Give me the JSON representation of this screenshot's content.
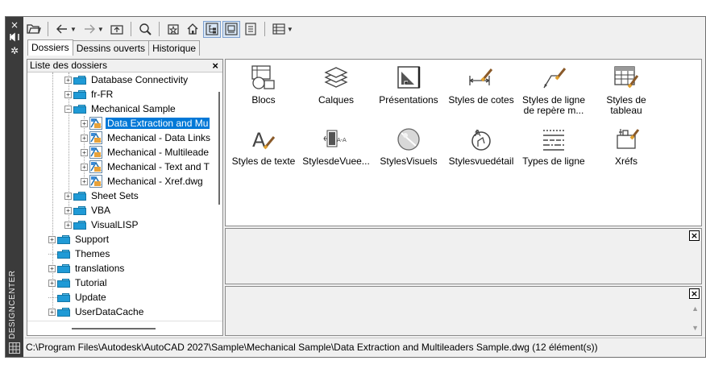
{
  "window": {
    "side_title": "DESIGNCENTER",
    "close_glyph": "×",
    "autohide_glyph": "⧓",
    "props_glyph": "✲"
  },
  "tabs": [
    {
      "label": "Dossiers",
      "active": true
    },
    {
      "label": "Dessins ouverts",
      "active": false
    },
    {
      "label": "Historique",
      "active": false
    }
  ],
  "tree": {
    "header": "Liste des dossiers",
    "close_glyph": "×",
    "rows": [
      {
        "label": "Database Connectivity",
        "level": 2,
        "expander": "+",
        "icon": "folder"
      },
      {
        "label": "fr-FR",
        "level": 2,
        "expander": "+",
        "icon": "folder"
      },
      {
        "label": "Mechanical Sample",
        "level": 2,
        "expander": "−",
        "icon": "folder"
      },
      {
        "label": "Data Extraction and Mu",
        "level": 3,
        "expander": "+",
        "icon": "dwg",
        "selected": true
      },
      {
        "label": "Mechanical - Data Links",
        "level": 3,
        "expander": "+",
        "icon": "dwg"
      },
      {
        "label": "Mechanical - Multileade",
        "level": 3,
        "expander": "+",
        "icon": "dwg"
      },
      {
        "label": "Mechanical - Text and T",
        "level": 3,
        "expander": "+",
        "icon": "dwg"
      },
      {
        "label": "Mechanical - Xref.dwg",
        "level": 3,
        "expander": "+",
        "icon": "dwg"
      },
      {
        "label": "Sheet Sets",
        "level": 2,
        "expander": "+",
        "icon": "folder"
      },
      {
        "label": "VBA",
        "level": 2,
        "expander": "+",
        "icon": "folder"
      },
      {
        "label": "VisualLISP",
        "level": 2,
        "expander": "+",
        "icon": "folder"
      },
      {
        "label": "Support",
        "level": 1,
        "expander": "+",
        "icon": "folder"
      },
      {
        "label": "Themes",
        "level": 1,
        "expander": "",
        "icon": "folder"
      },
      {
        "label": "translations",
        "level": 1,
        "expander": "+",
        "icon": "folder"
      },
      {
        "label": "Tutorial",
        "level": 1,
        "expander": "+",
        "icon": "folder"
      },
      {
        "label": "Update",
        "level": 1,
        "expander": "",
        "icon": "folder"
      },
      {
        "label": "UserDataCache",
        "level": 1,
        "expander": "+",
        "icon": "folder"
      }
    ]
  },
  "content": {
    "items": [
      {
        "label": "Blocs",
        "icon": "blocks-icon"
      },
      {
        "label": "Calques",
        "icon": "layers-icon"
      },
      {
        "label": "Présentations",
        "icon": "layouts-icon"
      },
      {
        "label": "Styles de cotes",
        "icon": "dimstyles-icon"
      },
      {
        "label": "Styles de ligne de repère m...",
        "icon": "mleaderstyles-icon"
      },
      {
        "label": "Styles de tableau",
        "icon": "tablestyles-icon"
      },
      {
        "label": "Styles de texte",
        "icon": "textstyles-icon"
      },
      {
        "label": "StylesdeVuee...",
        "icon": "viewstyles-icon"
      },
      {
        "label": "StylesVisuels",
        "icon": "visualstyles-icon"
      },
      {
        "label": "Stylesvuedétail",
        "icon": "detailviewstyles-icon"
      },
      {
        "label": "Types de ligne",
        "icon": "linetypes-icon"
      },
      {
        "label": "Xréfs",
        "icon": "xrefs-icon"
      }
    ]
  },
  "panels": {
    "close_glyph": "×",
    "up_glyph": "▲",
    "down_glyph": "▼"
  },
  "status": {
    "path": "C:\\Program Files\\Autodesk\\AutoCAD 2027\\Sample\\Mechanical Sample\\Data Extraction and Multileaders Sample.dwg (12 élément(s))"
  },
  "colors": {
    "selection": "#0078d7",
    "folder": "#1f9ad6",
    "title_strip": "#3b3b3b"
  }
}
